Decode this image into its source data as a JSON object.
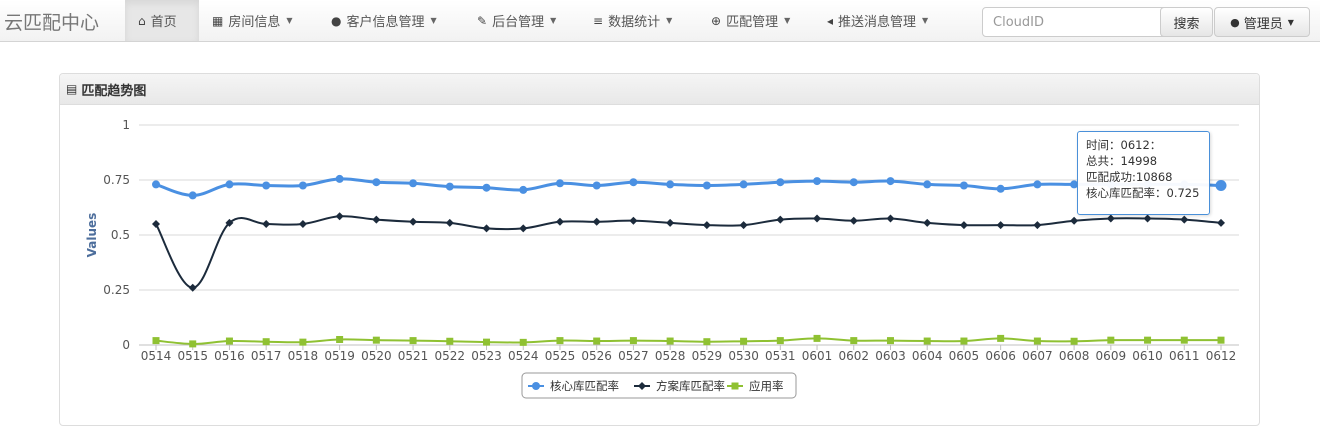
{
  "brand": "云匹配中心",
  "nav": [
    {
      "icon": "home-icon",
      "glyph": "⌂",
      "label": "首页",
      "caret": false,
      "active": true
    },
    {
      "icon": "grid-icon",
      "glyph": "▦",
      "label": "房间信息",
      "caret": true,
      "active": false
    },
    {
      "icon": "user-icon",
      "glyph": "●",
      "label": "客户信息管理",
      "caret": true,
      "active": false
    },
    {
      "icon": "edit-icon",
      "glyph": "✎",
      "label": "后台管理",
      "caret": true,
      "active": false
    },
    {
      "icon": "list-icon",
      "glyph": "≡",
      "label": "数据统计",
      "caret": true,
      "active": false
    },
    {
      "icon": "zoom-icon",
      "glyph": "⊕",
      "label": "匹配管理",
      "caret": true,
      "active": false
    },
    {
      "icon": "volume-icon",
      "glyph": "◂",
      "label": "推送消息管理",
      "caret": true,
      "active": false
    }
  ],
  "search": {
    "placeholder": "CloudID",
    "button": "搜索"
  },
  "admin": {
    "label": "管理员"
  },
  "panel": {
    "title": "匹配趋势图"
  },
  "tooltip": {
    "time": "时间：0612：",
    "total": "总共：14998",
    "success": "匹配成功:10868",
    "rate": "核心库匹配率：0.725"
  },
  "chart_data": {
    "type": "line",
    "ylabel": "Values",
    "ylim": [
      0,
      1
    ],
    "yticks": [
      "0",
      "0.25",
      "0.5",
      "0.75",
      "1"
    ],
    "yvalues": [
      0,
      0.25,
      0.5,
      0.75,
      1
    ],
    "categories": [
      "0514",
      "0515",
      "0516",
      "0517",
      "0518",
      "0519",
      "0520",
      "0521",
      "0522",
      "0523",
      "0524",
      "0525",
      "0526",
      "0527",
      "0528",
      "0529",
      "0530",
      "0531",
      "0601",
      "0602",
      "0603",
      "0604",
      "0605",
      "0606",
      "0607",
      "0608",
      "0609",
      "0610",
      "0611",
      "0612"
    ],
    "series": [
      {
        "name": "核心库匹配率",
        "color": "#4a90e2",
        "marker": "circle",
        "values": [
          0.73,
          0.68,
          0.73,
          0.725,
          0.725,
          0.755,
          0.74,
          0.735,
          0.72,
          0.715,
          0.705,
          0.735,
          0.725,
          0.74,
          0.73,
          0.725,
          0.73,
          0.74,
          0.745,
          0.74,
          0.745,
          0.73,
          0.725,
          0.71,
          0.73,
          0.73,
          0.73,
          0.73,
          0.73,
          0.725
        ]
      },
      {
        "name": "方案库匹配率",
        "color": "#1c2b3c",
        "marker": "diamond",
        "values": [
          0.55,
          0.26,
          0.555,
          0.55,
          0.55,
          0.585,
          0.57,
          0.56,
          0.555,
          0.53,
          0.53,
          0.56,
          0.56,
          0.565,
          0.555,
          0.545,
          0.545,
          0.57,
          0.575,
          0.565,
          0.575,
          0.555,
          0.545,
          0.545,
          0.545,
          0.565,
          0.575,
          0.575,
          0.57,
          0.555
        ]
      },
      {
        "name": "应用率",
        "color": "#8fc132",
        "marker": "square",
        "values": [
          0.02,
          0.005,
          0.018,
          0.015,
          0.013,
          0.025,
          0.022,
          0.02,
          0.017,
          0.013,
          0.012,
          0.02,
          0.018,
          0.02,
          0.018,
          0.015,
          0.017,
          0.02,
          0.03,
          0.02,
          0.02,
          0.018,
          0.018,
          0.03,
          0.018,
          0.017,
          0.022,
          0.022,
          0.022,
          0.022
        ]
      }
    ],
    "legend": "bottom-center",
    "grid": true
  }
}
